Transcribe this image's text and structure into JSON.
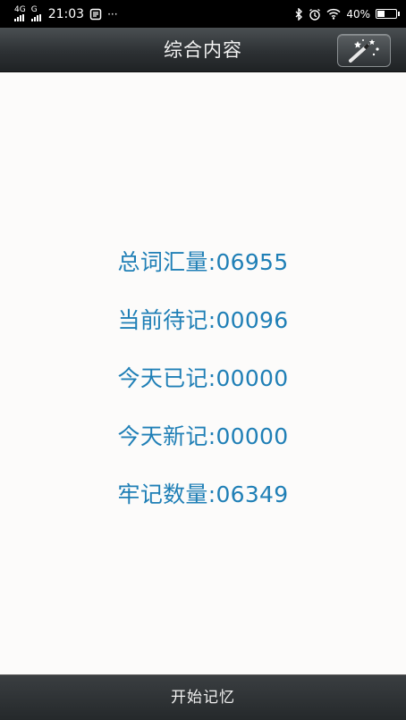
{
  "status_bar": {
    "network_1": "4G",
    "network_2": "G",
    "time": "21:03",
    "more": "···",
    "battery_percent": "40%",
    "battery_level": 0.4
  },
  "header": {
    "title": "综合内容",
    "magic_button_icon": "magic-wand-icon"
  },
  "stats": [
    {
      "label": "总词汇量:06955"
    },
    {
      "label": "当前待记:00096"
    },
    {
      "label": "今天已记:00000"
    },
    {
      "label": "今天新记:00000"
    },
    {
      "label": "牢记数量:06349"
    }
  ],
  "footer": {
    "start_label": "开始记忆"
  },
  "colors": {
    "stat_text": "#1f7fb6",
    "bar_dark": "#2d3134",
    "background": "#fcfbfa"
  }
}
